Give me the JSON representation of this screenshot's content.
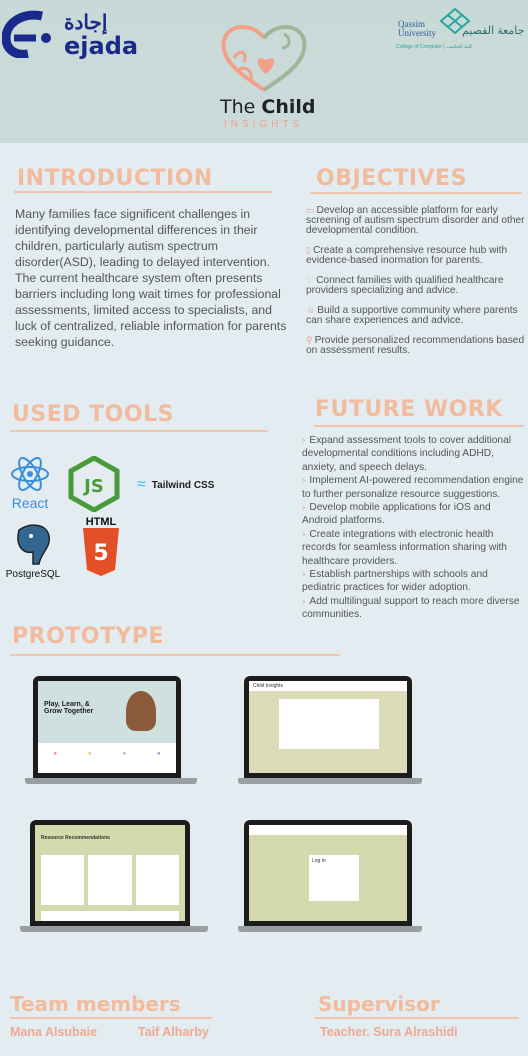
{
  "header": {
    "ejada_logo": {
      "arabic": "إجادة",
      "latin": "ejada",
      "color": "#1a2a8c"
    },
    "qassim_logo": {
      "name": "Qassim University",
      "arabic": "جامعة القصيم",
      "subtitle": "College of Computer | كلية الحاسب"
    },
    "app_logo": {
      "title_light": "The",
      "title_bold": "Child",
      "subtitle": "INSIGHTS"
    }
  },
  "introduction": {
    "title": "INTRODUCTION",
    "text": "Many families face significent challenges in identifying developmental differences in their children, particularly autism spectrum disorder(ASD), leading to delayed intervention. The current healthcare system often presents barriers including long wait times for professional assessments, limited access to specialists, and luck of centralized, reliable information for parents seeking guidance."
  },
  "objectives": {
    "title": "OBJECTIVES",
    "items": [
      {
        "icon": "laptop-icon",
        "text": "Develop an accessible platform for early screening of autism spectrum disorder and other developmental condition."
      },
      {
        "icon": "book-icon",
        "text": "Create a comprehensive resource hub with evidence-based inormation for parents."
      },
      {
        "icon": "stethoscope-icon",
        "text": "Connect families with qualified healthcare providers specializing and advice."
      },
      {
        "icon": "community-icon",
        "text": "Build a supportive community where parents can share experiences and advice."
      },
      {
        "icon": "search-icon",
        "text": "Provide personalized recommendations based on assessment results."
      }
    ]
  },
  "tools": {
    "title": "USED TOOLS",
    "items": [
      "React",
      "Tailwind CSS",
      "PostgreSQL",
      "HTML"
    ],
    "js_label": "JS"
  },
  "future": {
    "title": "FUTURE WORK",
    "items": [
      "Expand assessment tools to cover additional developmental conditions including ADHD, anxiety, and speech delays.",
      "Implement AI-powered recommendation engine to further personalize resource suggestions.",
      "Develop mobile applications for iOS and Android platforms.",
      "Create integrations with electronic health records for seamless information sharing with healthcare providers.",
      "Establish partnerships with schools and pediatric practices for wider adoption.",
      "Add multilingual support to reach more diverse communities."
    ]
  },
  "prototype": {
    "title": "PROTOTYPE",
    "screens": [
      {
        "heading": "Play, Learn, & Grow Together"
      },
      {
        "heading": "Child Insights"
      },
      {
        "heading": "Resource Recommendations"
      },
      {
        "heading": "Log in"
      }
    ]
  },
  "team": {
    "title": "Team members",
    "members": [
      "Mana Alsubaie",
      "Taif Alharby"
    ]
  },
  "supervisor": {
    "title": "Supervisor",
    "name": "Teacher. Sura Alrashidi"
  },
  "colors": {
    "accent": "#f2bb9e",
    "text": "#555555",
    "background": "#e3ecf0"
  }
}
